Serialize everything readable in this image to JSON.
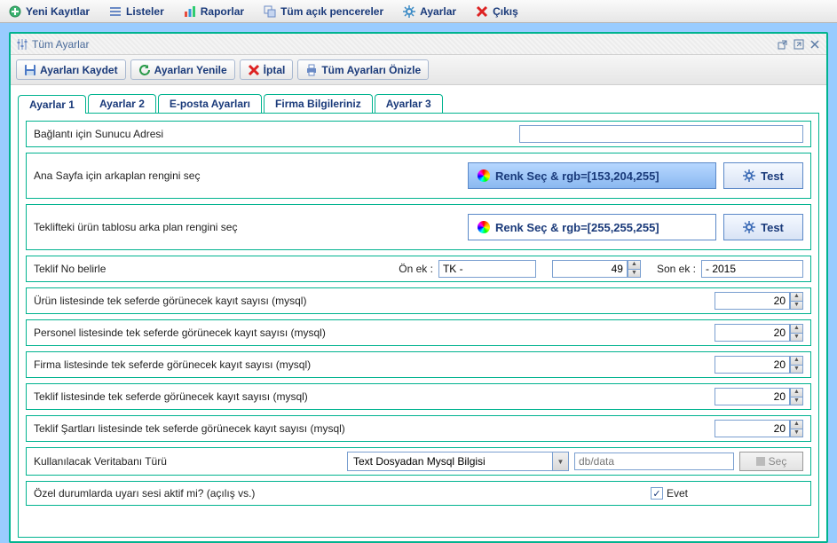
{
  "menubar": [
    {
      "label": "Yeni Kayıtlar",
      "icon": "plus-green"
    },
    {
      "label": "Listeler",
      "icon": "list"
    },
    {
      "label": "Raporlar",
      "icon": "chart"
    },
    {
      "label": "Tüm açık pencereler",
      "icon": "windows"
    },
    {
      "label": "Ayarlar",
      "icon": "gear"
    },
    {
      "label": "Çıkış",
      "icon": "close-red"
    }
  ],
  "window": {
    "title": "Tüm Ayarlar"
  },
  "toolbar": {
    "save": "Ayarları Kaydet",
    "refresh": "Ayarları Yenile",
    "cancel": "İptal",
    "preview": "Tüm Ayarları Önizle"
  },
  "tabs": [
    "Ayarlar 1",
    "Ayarlar 2",
    "E-posta Ayarları",
    "Firma Bilgileriniz",
    "Ayarlar 3"
  ],
  "rows": {
    "server": {
      "label": "Bağlantı için Sunucu Adresi",
      "value": ""
    },
    "bgcolor_home": {
      "label": "Ana Sayfa için arkaplan rengini seç",
      "btn": "Renk Seç  &  rgb=[153,204,255]",
      "test": "Test"
    },
    "bgcolor_table": {
      "label": "Teklifteki ürün tablosu arka plan rengini seç",
      "btn": "Renk Seç  &  rgb=[255,255,255]",
      "test": "Test"
    },
    "offerno": {
      "label": "Teklif No belirle",
      "prefix_label": "Ön ek :",
      "prefix": "TK -",
      "number": "49",
      "suffix_label": "Son ek :",
      "suffix": "- 2015"
    },
    "urun": {
      "label": "Ürün listesinde tek seferde görünecek kayıt sayısı (mysql)",
      "value": "20"
    },
    "personel": {
      "label": "Personel listesinde tek seferde görünecek kayıt sayısı (mysql)",
      "value": "20"
    },
    "firma": {
      "label": "Firma listesinde tek seferde görünecek kayıt sayısı (mysql)",
      "value": "20"
    },
    "teklif": {
      "label": "Teklif listesinde tek seferde görünecek kayıt sayısı (mysql)",
      "value": "20"
    },
    "teklifsart": {
      "label": "Teklif Şartları listesinde tek seferde görünecek kayıt sayısı (mysql)",
      "value": "20"
    },
    "db": {
      "label": "Kullanılacak Veritabanı Türü",
      "combo": "Text Dosyadan Mysql Bilgisi",
      "path_placeholder": "db/data",
      "select": "Seç"
    },
    "alert": {
      "label": "Özel durumlarda uyarı sesi aktif mi? (açılış vs.)",
      "chk": "Evet",
      "checked": true
    }
  }
}
